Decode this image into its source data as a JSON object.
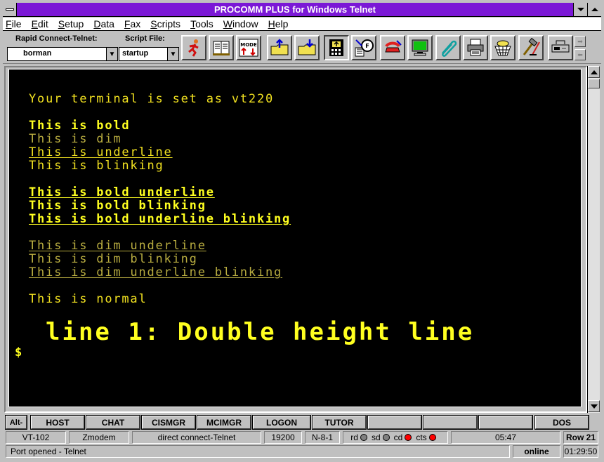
{
  "window": {
    "title": "PROCOMM PLUS for Windows Telnet"
  },
  "menu": [
    "File",
    "Edit",
    "Setup",
    "Data",
    "Fax",
    "Scripts",
    "Tools",
    "Window",
    "Help"
  ],
  "toolbar": {
    "rapid_connect_label": "Rapid Connect-Telnet:",
    "rapid_connect_value": "borman",
    "script_file_label": "Script File:",
    "script_file_value": "startup",
    "mode_label": "MODE"
  },
  "terminal": {
    "lines": [
      "Your terminal is set as vt220",
      "This is bold",
      "This is dim",
      "This is underline",
      "This is blinking",
      "This is bold underline",
      "This is bold blinking",
      "This is bold underline blinking",
      "This is dim underline",
      "This is dim blinking",
      "This is dim underline blinking",
      "This is normal",
      "line 1: Double height line",
      "$"
    ]
  },
  "meta_keys": [
    "Alt-",
    "HOST",
    "CHAT",
    "CISMGR",
    "MCIMGR",
    "LOGON",
    "TUTOR",
    "",
    "",
    "",
    "DOS"
  ],
  "status": {
    "emulation": "VT-102",
    "protocol": "Zmodem",
    "connection": "direct connect-Telnet",
    "baud": "19200",
    "settings": "N-8-1",
    "indicators": [
      {
        "label": "rd",
        "color": "#808080"
      },
      {
        "label": "sd",
        "color": "#808080"
      },
      {
        "label": "cd",
        "color": "#ff0000"
      },
      {
        "label": "cts",
        "color": "#ff0000"
      }
    ],
    "time": "05:47",
    "row": "Row 21",
    "message": "Port opened - Telnet",
    "state": "online",
    "elapsed": "01:29:50"
  }
}
